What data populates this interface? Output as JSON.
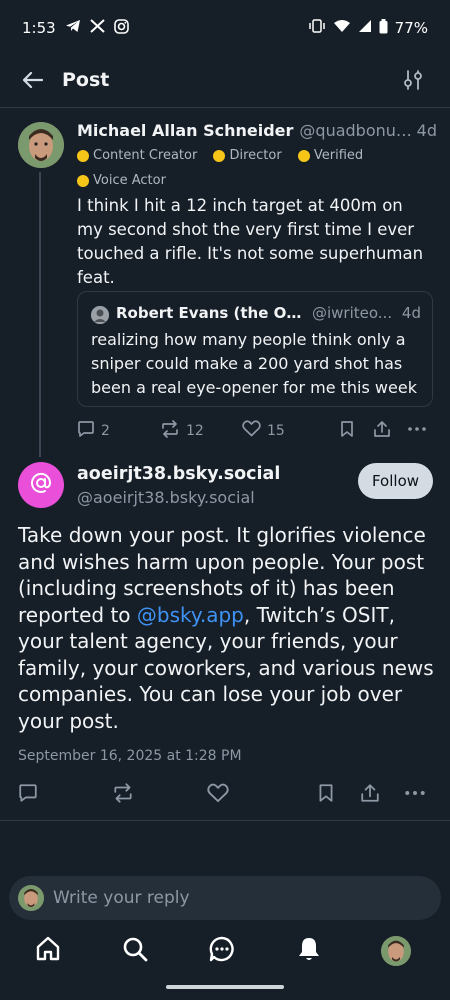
{
  "status_bar": {
    "time": "1:53",
    "battery": "77%"
  },
  "header": {
    "title": "Post"
  },
  "parent_post": {
    "author_name": "Michael Allan Schneider",
    "author_handle": "@quadbonus....",
    "time": "4d",
    "badges": [
      "Content Creator",
      "Director",
      "Verified",
      "Voice Actor"
    ],
    "badge_color": "#f5c518",
    "text": "I think I hit a 12 inch target at 400m on my second shot the very first time I ever touched a rifle. It's not some superhuman feat.",
    "quote": {
      "author_name": "Robert Evans (the Onl...",
      "author_handle": "@iwriteo...",
      "time": "4d",
      "text": "realizing how many people think only a sniper could make a 200 yard shot has been a real eye-opener for me this week"
    },
    "actions": {
      "replies": "2",
      "reposts": "12",
      "likes": "15"
    }
  },
  "main_post": {
    "display_name": "aoeirjt38.bsky.social",
    "handle": "@aoeirjt38.bsky.social",
    "follow_label": "Follow",
    "avatar_color": "#e94fd8",
    "text_before_mention": "Take down your post. It glorifies violence and wishes harm upon people. Your post (including screenshots of it) has been reported to ",
    "mention": "@bsky.app",
    "text_after_mention": ", Twitch’s OSIT, your talent agency, your friends, your family, your coworkers, and various news companies. You can lose your job over your post.",
    "timestamp": "September 16, 2025 at 1:28 PM"
  },
  "reply_box": {
    "placeholder": "Write your reply"
  },
  "colors": {
    "background": "#161e27",
    "link": "#3f93f5",
    "muted": "#8d98a5"
  }
}
